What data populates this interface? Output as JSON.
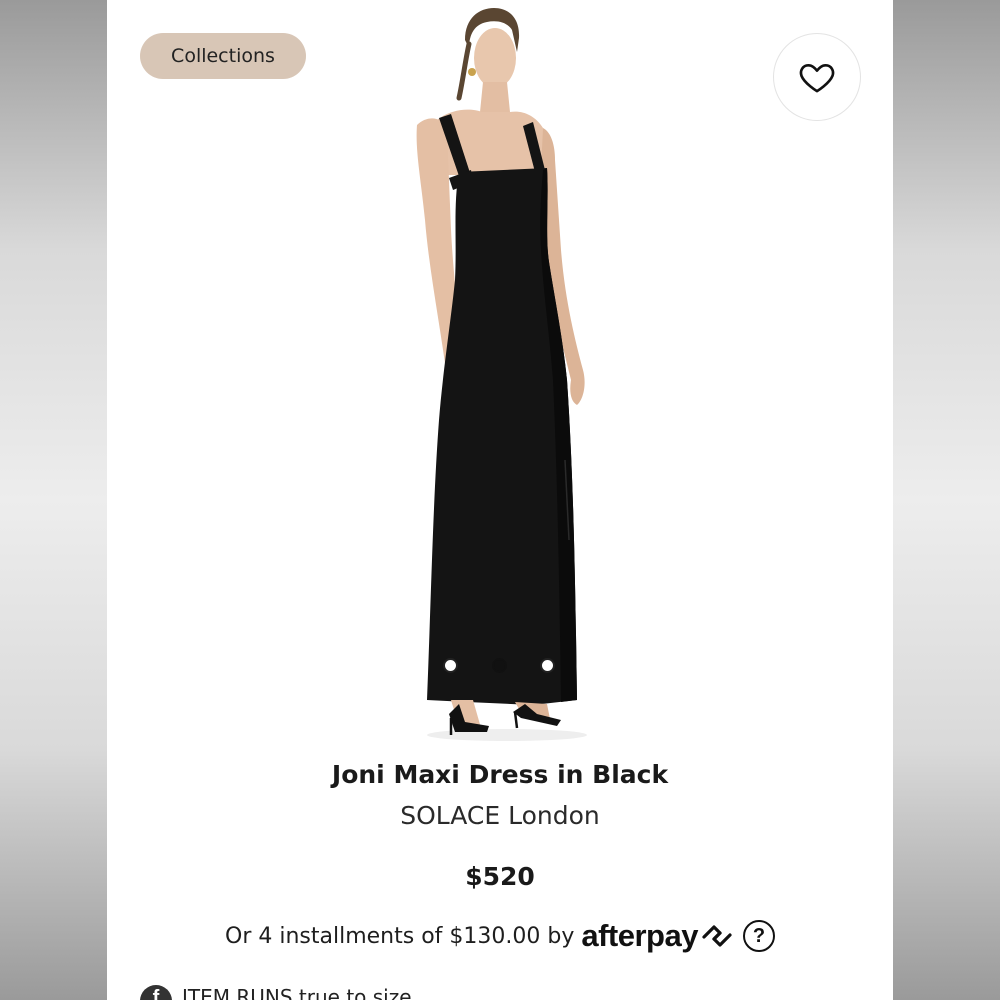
{
  "header": {
    "collections_label": "Collections"
  },
  "gallery": {
    "dot_count": 3,
    "active_dot_index": 1
  },
  "product": {
    "title": "Joni Maxi Dress in Black",
    "brand": "SOLACE London",
    "price": "$520"
  },
  "afterpay": {
    "installments_text": "Or 4 installments of $130.00 by",
    "logo_text": "afterpay"
  },
  "footer": {
    "partial_text": "ITEM RUNS true to size"
  },
  "icons": {
    "favorite": "heart-outline-icon",
    "help": "question-circle-icon",
    "social": "facebook-icon"
  },
  "colors": {
    "chip_bg": "#d8c6b6",
    "dress": "#141414"
  }
}
